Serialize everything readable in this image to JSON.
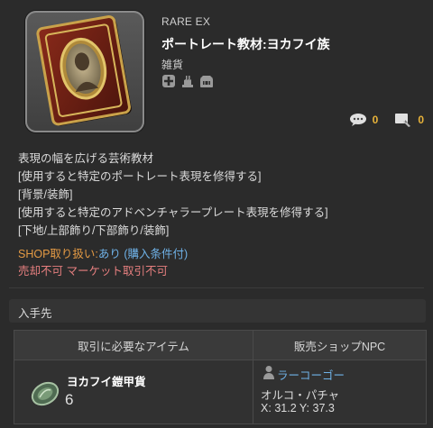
{
  "item": {
    "rarity": "RARE EX",
    "name": "ポートレート教材:ヨカフイ族",
    "category": "雑貨",
    "icon": "portrait-book-icon",
    "flags": [
      "unique-icon",
      "untradable-icon",
      "no-market-icon"
    ],
    "comments_count": "0",
    "screenshots_count": "0"
  },
  "description": [
    "表現の幅を広げる芸術教材",
    "[使用すると特定のポートレート表現を修得する]",
    "[背景/装飾]",
    "[使用すると特定のアドベンチャラープレート表現を修得する]",
    "[下地/上部飾り/下部飾り/装飾]"
  ],
  "shop": {
    "label": "SHOP取り扱い:",
    "value": "あり (購入条件付)",
    "restrictions": "売却不可 マーケット取引不可"
  },
  "acquisition": {
    "title": "入手先",
    "headers": [
      "取引に必要なアイテム",
      "販売ショップNPC"
    ],
    "currency": {
      "icon": "currency-icon",
      "name": "ヨカフイ鎧甲貨",
      "qty": "6"
    },
    "npc": {
      "icon": "person-icon",
      "name": "ラーコーゴー",
      "place": "オルコ・パチャ",
      "coords": "X: 31.2 Y: 37.3"
    }
  },
  "colors": {
    "background": "#2b2b2b",
    "link": "#6fb2e8",
    "label_orange": "#e49a44",
    "warning_red": "#e67f7f",
    "count_yellow": "#e8b33a"
  }
}
